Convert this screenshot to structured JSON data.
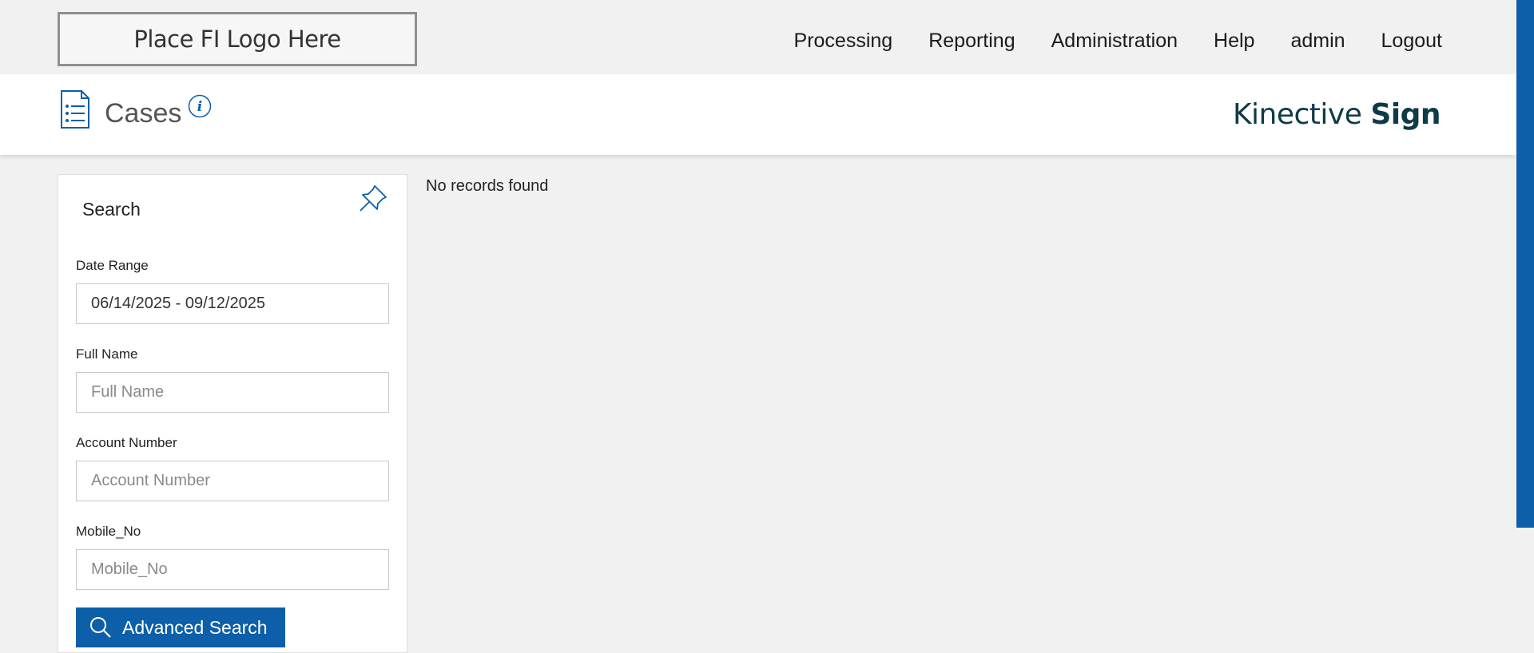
{
  "logo": {
    "text": "Place FI Logo Here"
  },
  "nav": {
    "items": [
      "Processing",
      "Reporting",
      "Administration",
      "Help",
      "admin",
      "Logout"
    ]
  },
  "header": {
    "title": "Cases",
    "brand_light": "Kinective ",
    "brand_bold": "Sign",
    "icons": {
      "page": "list-document-icon",
      "info": "info-icon"
    }
  },
  "search_panel": {
    "title": "Search",
    "pin_icon": "pin-icon",
    "date_range": {
      "label": "Date Range",
      "value": "06/14/2025 - 09/12/2025"
    },
    "full_name": {
      "label": "Full Name",
      "placeholder": "Full Name",
      "value": ""
    },
    "account_number": {
      "label": "Account Number",
      "placeholder": "Account Number",
      "value": ""
    },
    "mobile_no": {
      "label": "Mobile_No",
      "placeholder": "Mobile_No",
      "value": ""
    },
    "advanced_search_label": "Advanced Search"
  },
  "results": {
    "empty_message": "No records found"
  },
  "colors": {
    "accent": "#0c5fa8",
    "brand": "#0d3b47",
    "background": "#f1f1f1"
  }
}
